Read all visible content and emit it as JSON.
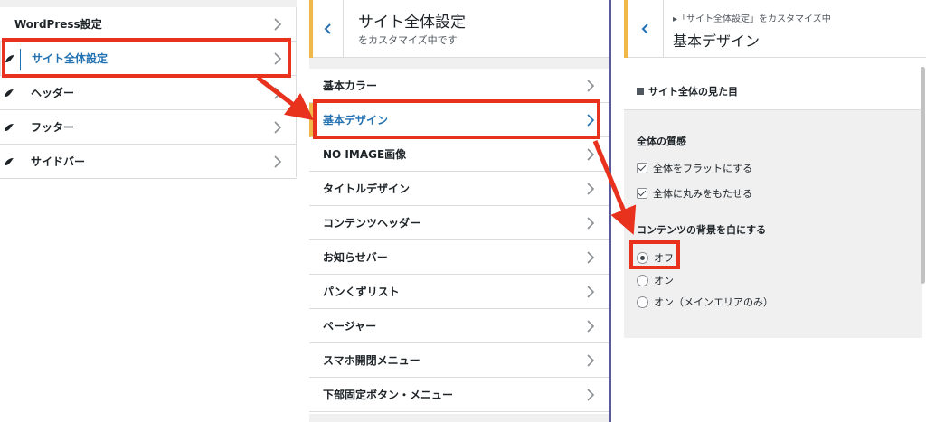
{
  "panel1": {
    "header": "WordPress設定",
    "items": [
      {
        "label": "サイト全体設定"
      },
      {
        "label": "ヘッダー"
      },
      {
        "label": "フッター"
      },
      {
        "label": "サイドバー"
      }
    ]
  },
  "panel2": {
    "title": "サイト全体設定",
    "subtitle": "をカスタマイズ中です",
    "items": [
      {
        "label": "基本カラー"
      },
      {
        "label": "基本デザイン"
      },
      {
        "label": "NO IMAGE画像"
      },
      {
        "label": "タイトルデザイン"
      },
      {
        "label": "コンテンツヘッダー"
      },
      {
        "label": "お知らせバー"
      },
      {
        "label": "パンくずリスト"
      },
      {
        "label": "ページャー"
      },
      {
        "label": "スマホ開閉メニュー"
      },
      {
        "label": "下部固定ボタン・メニュー"
      }
    ]
  },
  "panel3": {
    "breadcrumb": "▸「サイト全体設定」をカスタマイズ中",
    "title": "基本デザイン",
    "section_title": "サイト全体の見た目",
    "group1": {
      "title": "全体の質感",
      "checkboxes": [
        {
          "label": "全体をフラットにする",
          "checked": true
        },
        {
          "label": "全体に丸みをもたせる",
          "checked": true
        }
      ]
    },
    "group2": {
      "title": "コンテンツの背景を白にする",
      "radios": [
        {
          "label": "オフ",
          "selected": true
        },
        {
          "label": "オン",
          "selected": false
        },
        {
          "label": "オン（メインエリアのみ）",
          "selected": false
        }
      ]
    }
  },
  "colors": {
    "accent": "#2271b1",
    "highlight": "#e8321e",
    "active_border": "#f0b849"
  }
}
